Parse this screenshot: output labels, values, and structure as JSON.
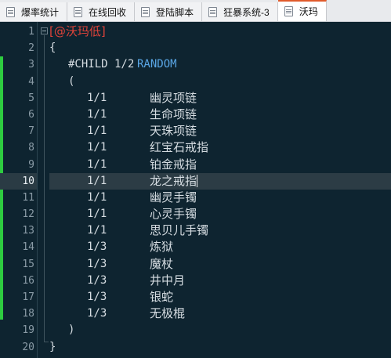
{
  "tabs": [
    {
      "label": "爆率统计",
      "active": false
    },
    {
      "label": "在线回收",
      "active": false
    },
    {
      "label": "登陆脚本",
      "active": false
    },
    {
      "label": "狂暴系统-3",
      "active": false
    },
    {
      "label": "沃玛",
      "active": true
    }
  ],
  "editor": {
    "current_line": 10,
    "lines": [
      {
        "n": "1",
        "header": "[@沃玛低]"
      },
      {
        "n": "2",
        "text": "{"
      },
      {
        "n": "3",
        "directive": "#CHILD 1/2",
        "keyword": "RANDOM"
      },
      {
        "n": "4",
        "text": "("
      },
      {
        "n": "5",
        "rate": "1/1",
        "item": "幽灵项链"
      },
      {
        "n": "6",
        "rate": "1/1",
        "item": "生命项链"
      },
      {
        "n": "7",
        "rate": "1/1",
        "item": "天珠项链"
      },
      {
        "n": "8",
        "rate": "1/1",
        "item": "红宝石戒指"
      },
      {
        "n": "9",
        "rate": "1/1",
        "item": "铂金戒指"
      },
      {
        "n": "10",
        "rate": "1/1",
        "item": "龙之戒指"
      },
      {
        "n": "11",
        "rate": "1/1",
        "item": "幽灵手镯"
      },
      {
        "n": "12",
        "rate": "1/1",
        "item": "心灵手镯"
      },
      {
        "n": "13",
        "rate": "1/1",
        "item": "思贝儿手镯"
      },
      {
        "n": "14",
        "rate": "1/3",
        "item": "炼狱"
      },
      {
        "n": "15",
        "rate": "1/3",
        "item": "魔杖"
      },
      {
        "n": "16",
        "rate": "1/3",
        "item": "井中月"
      },
      {
        "n": "17",
        "rate": "1/3",
        "item": "银蛇"
      },
      {
        "n": "18",
        "rate": "1/3",
        "item": "无极棍"
      },
      {
        "n": "19",
        "text": ")"
      },
      {
        "n": "20",
        "text": "}"
      }
    ]
  },
  "colors": {
    "background": "#0e2430",
    "header": "#e0433a",
    "keyword": "#5aa7e6",
    "changed_marker": "#2ecc40",
    "active_tab_accent": "#e05a2b"
  }
}
